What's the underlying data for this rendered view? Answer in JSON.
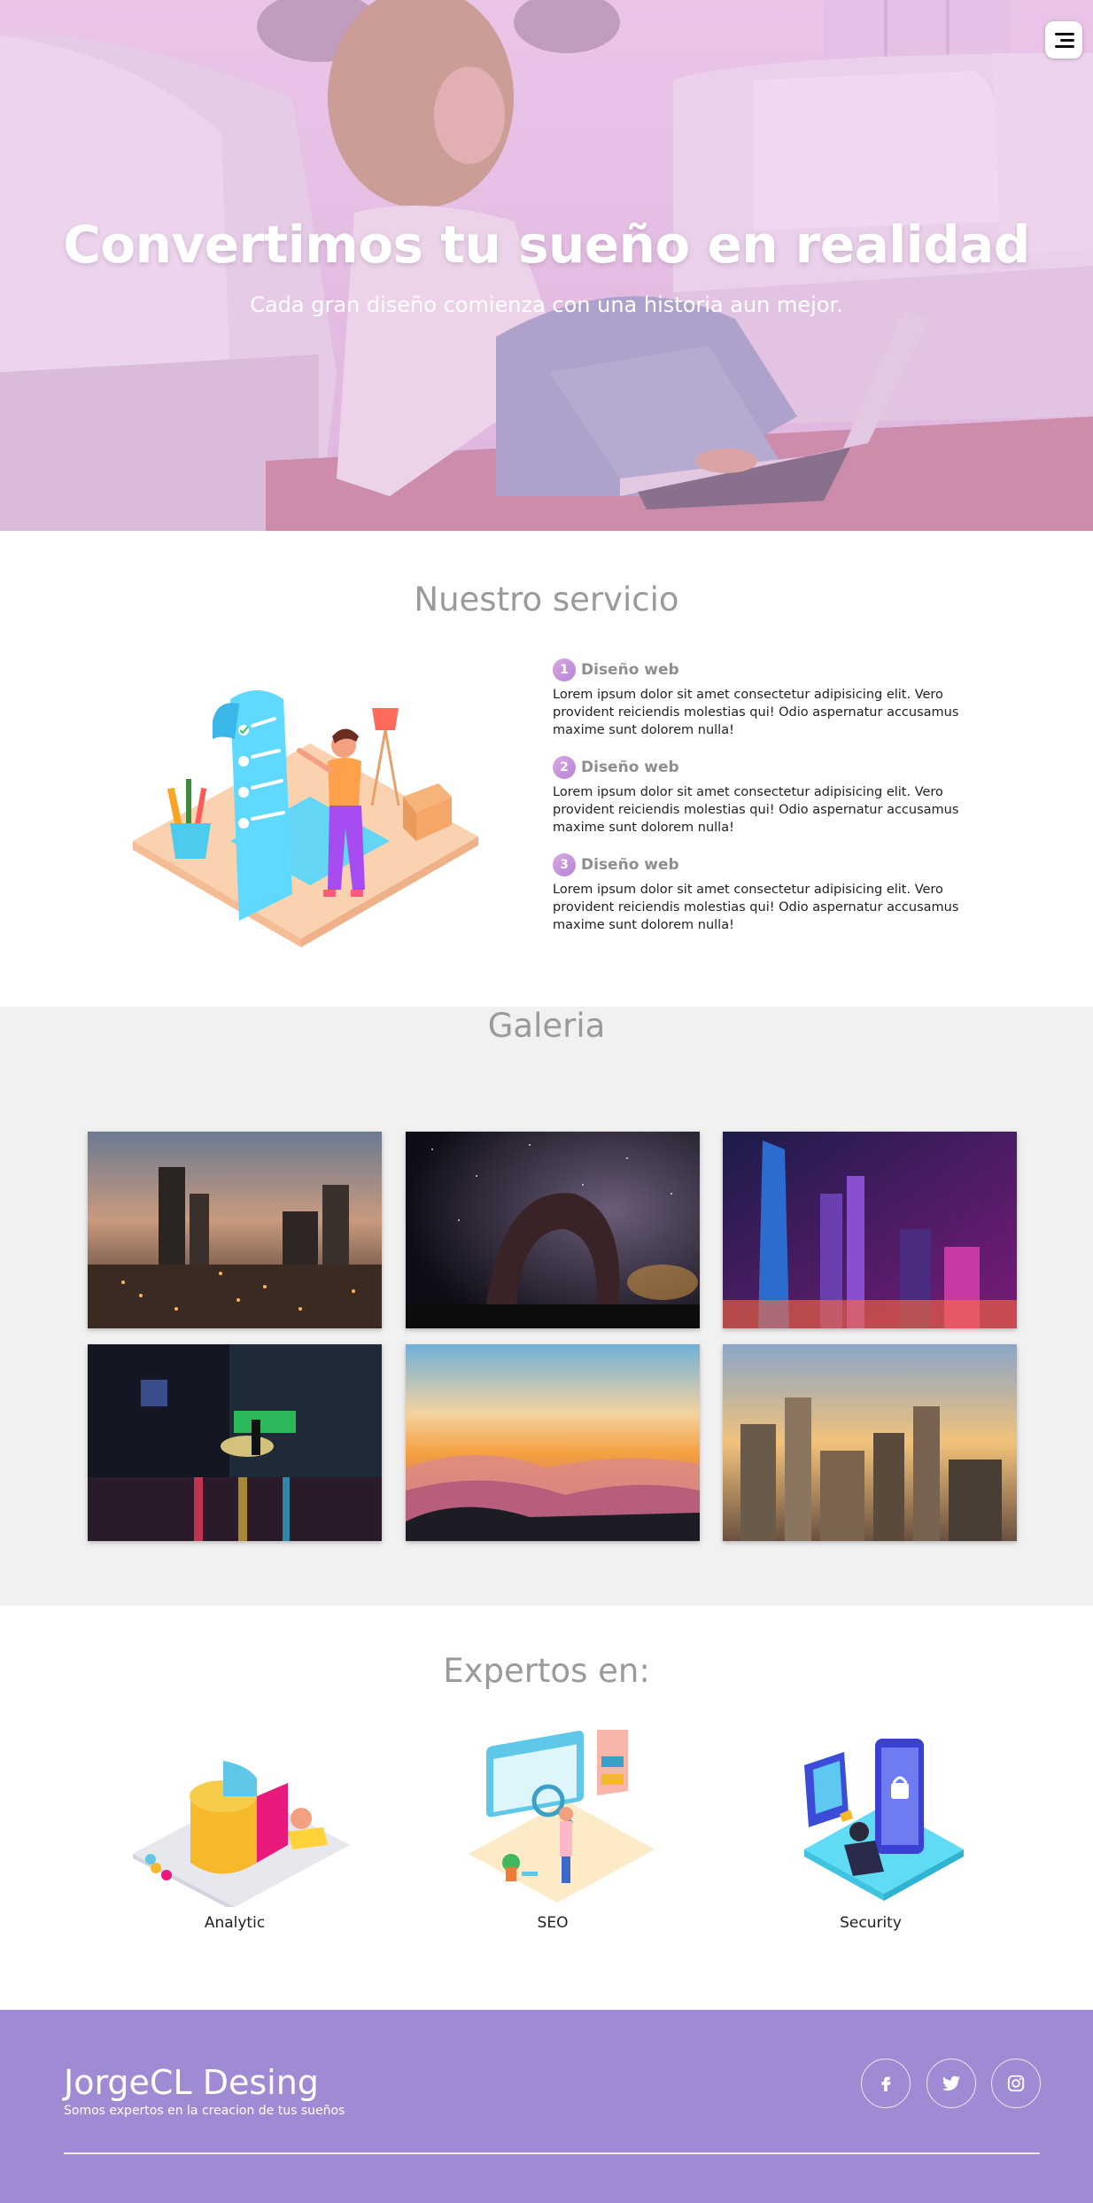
{
  "hero": {
    "title": "Convertimos tu sueño en realidad",
    "subtitle": "Cada gran diseño comienza con una historia aun mejor.",
    "menu_icon": "menu-lines-icon"
  },
  "services": {
    "title": "Nuestro servicio",
    "items": [
      {
        "number": "1",
        "name": "Diseño web",
        "text": "Lorem ipsum dolor sit amet consectetur adipisicing elit. Vero provident reiciendis molestias qui! Odio aspernatur accusamus maxime sunt dolorem nulla!"
      },
      {
        "number": "2",
        "name": "Diseño web",
        "text": "Lorem ipsum dolor sit amet consectetur adipisicing elit. Vero provident reiciendis molestias qui! Odio aspernatur accusamus maxime sunt dolorem nulla!"
      },
      {
        "number": "3",
        "name": "Diseño web",
        "text": "Lorem ipsum dolor sit amet consectetur adipisicing elit. Vero provident reiciendis molestias qui! Odio aspernatur accusamus maxime sunt dolorem nulla!"
      }
    ]
  },
  "gallery": {
    "title": "Galeria"
  },
  "experts": {
    "title": "Expertos en:",
    "items": [
      {
        "label": "Analytic"
      },
      {
        "label": "SEO"
      },
      {
        "label": "Security"
      }
    ]
  },
  "footer": {
    "brand": "JorgeCL Desing",
    "tagline": "Somos expertos en la creacion de tus sueños",
    "social": [
      "facebook-icon",
      "twitter-icon",
      "instagram-icon"
    ]
  },
  "colors": {
    "accent": "#a08ad4",
    "gallery_bg": "#f1f1f1",
    "heading_gray": "#9a9a9a"
  }
}
